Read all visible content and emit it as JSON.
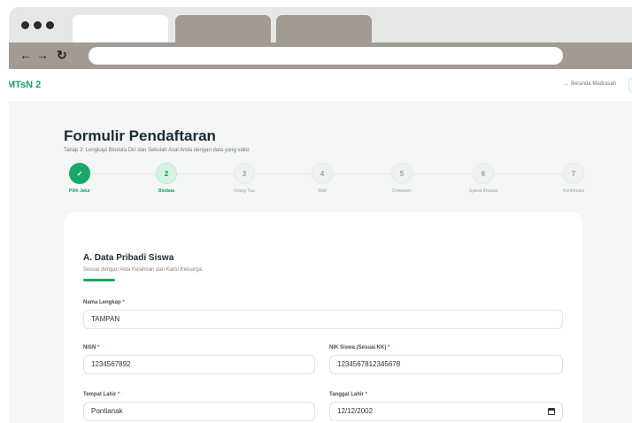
{
  "header": {
    "brand": "MTsN 2",
    "home_link": "← Beranda Madrasah"
  },
  "form": {
    "title": "Formulir Pendaftaran",
    "subtitle": "Tahap 2: Lengkapi Biodata Diri dan Sekolah Asal Anda dengan data yang valid."
  },
  "steps": [
    {
      "number": "✓",
      "label": "Pilih Jalur",
      "state": "done"
    },
    {
      "number": "2",
      "label": "Biodata",
      "state": "current"
    },
    {
      "number": "3",
      "label": "Orang Tua",
      "state": "pending"
    },
    {
      "number": "4",
      "label": "Wali",
      "state": "pending"
    },
    {
      "number": "5",
      "label": "Dokumen",
      "state": "pending"
    },
    {
      "number": "6",
      "label": "Syarat Khusus",
      "state": "pending"
    },
    {
      "number": "7",
      "label": "Konfirmasi",
      "state": "pending"
    }
  ],
  "section": {
    "title": "A. Data Pribadi Siswa",
    "subtitle": "Sesuai dengan Akta Kelahiran dan Kartu Keluarga."
  },
  "fields": {
    "nama": {
      "label": "Nama Lengkap",
      "value": "TAMPAN"
    },
    "nisn": {
      "label": "NISN",
      "value": "1234567892"
    },
    "nik": {
      "label": "NIK Siswa (Sesuai KK)",
      "value": "1234567812345678"
    },
    "tempat": {
      "label": "Tempat Lahir",
      "value": "Pontianak"
    },
    "tanggal": {
      "label": "Tanggal Lahir",
      "value": "12/12/2002"
    }
  },
  "required_mark": "*",
  "colors": {
    "accent": "#19a867",
    "chrome": "#a29b93",
    "required": "#e0452f"
  },
  "icons": [
    "back-arrow-icon",
    "forward-arrow-icon",
    "reload-icon",
    "checkmark-icon",
    "calendar-icon"
  ]
}
